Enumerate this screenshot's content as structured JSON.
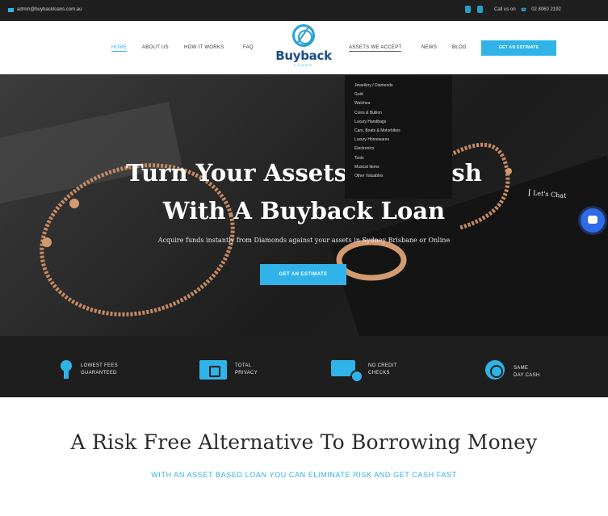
{
  "topbar": {
    "email": "admin@buybackloans.com.au",
    "phone_label": "Call us on",
    "phone": "02 8060 2192",
    "social": [
      "facebook-icon",
      "instagram-icon"
    ]
  },
  "nav": {
    "left_links": [
      "HOME",
      "ABOUT US",
      "HOW IT WORKS",
      "FAQ"
    ],
    "right_links": [
      "ASSETS WE ACCEPT",
      "NEWS",
      "BLOG"
    ],
    "cta": "GET AN ESTIMATE",
    "logo_name": "Buyback",
    "logo_sub": "LOANS"
  },
  "dropdown": {
    "items": [
      "Jewellery / Diamonds",
      "Gold",
      "Watches",
      "Coins & Bullion",
      "Luxury Handbags",
      "Cars, Boats & Motorbikes",
      "Luxury Homewares",
      "Electronics",
      "Tools",
      "Musical Items",
      "Other Valuables"
    ]
  },
  "hero": {
    "title_line1": "Turn Your Assets Into Cash",
    "title_line2": "With A Buyback Loan",
    "lead": "Acquire funds instantly from Diamonds against your assets in Sydney Brisbane or Online",
    "button": "GET AN ESTIMATE"
  },
  "chat": {
    "label": "Let's Chat"
  },
  "features": [
    {
      "icon": "location-pin-icon",
      "line1": "LOWEST FEES",
      "line2": "GUARANTEED"
    },
    {
      "icon": "lock-icon",
      "line1": "TOTAL",
      "line2": "PRIVACY"
    },
    {
      "icon": "credit-card-icon",
      "line1": "NO CREDIT",
      "line2": "CHECKS"
    },
    {
      "icon": "badge-icon",
      "line1": "SAME",
      "line2": "DAY CASH"
    }
  ],
  "section": {
    "title": "A Risk Free Alternative To Borrowing Money",
    "subtitle": "WITH AN ASSET BASED LOAN YOU CAN ELIMINATE RISK AND GET CASH FAST"
  },
  "colors": {
    "accent": "#2fb3e8",
    "dark": "#1e1e1e",
    "logo": "#1b4f86"
  }
}
